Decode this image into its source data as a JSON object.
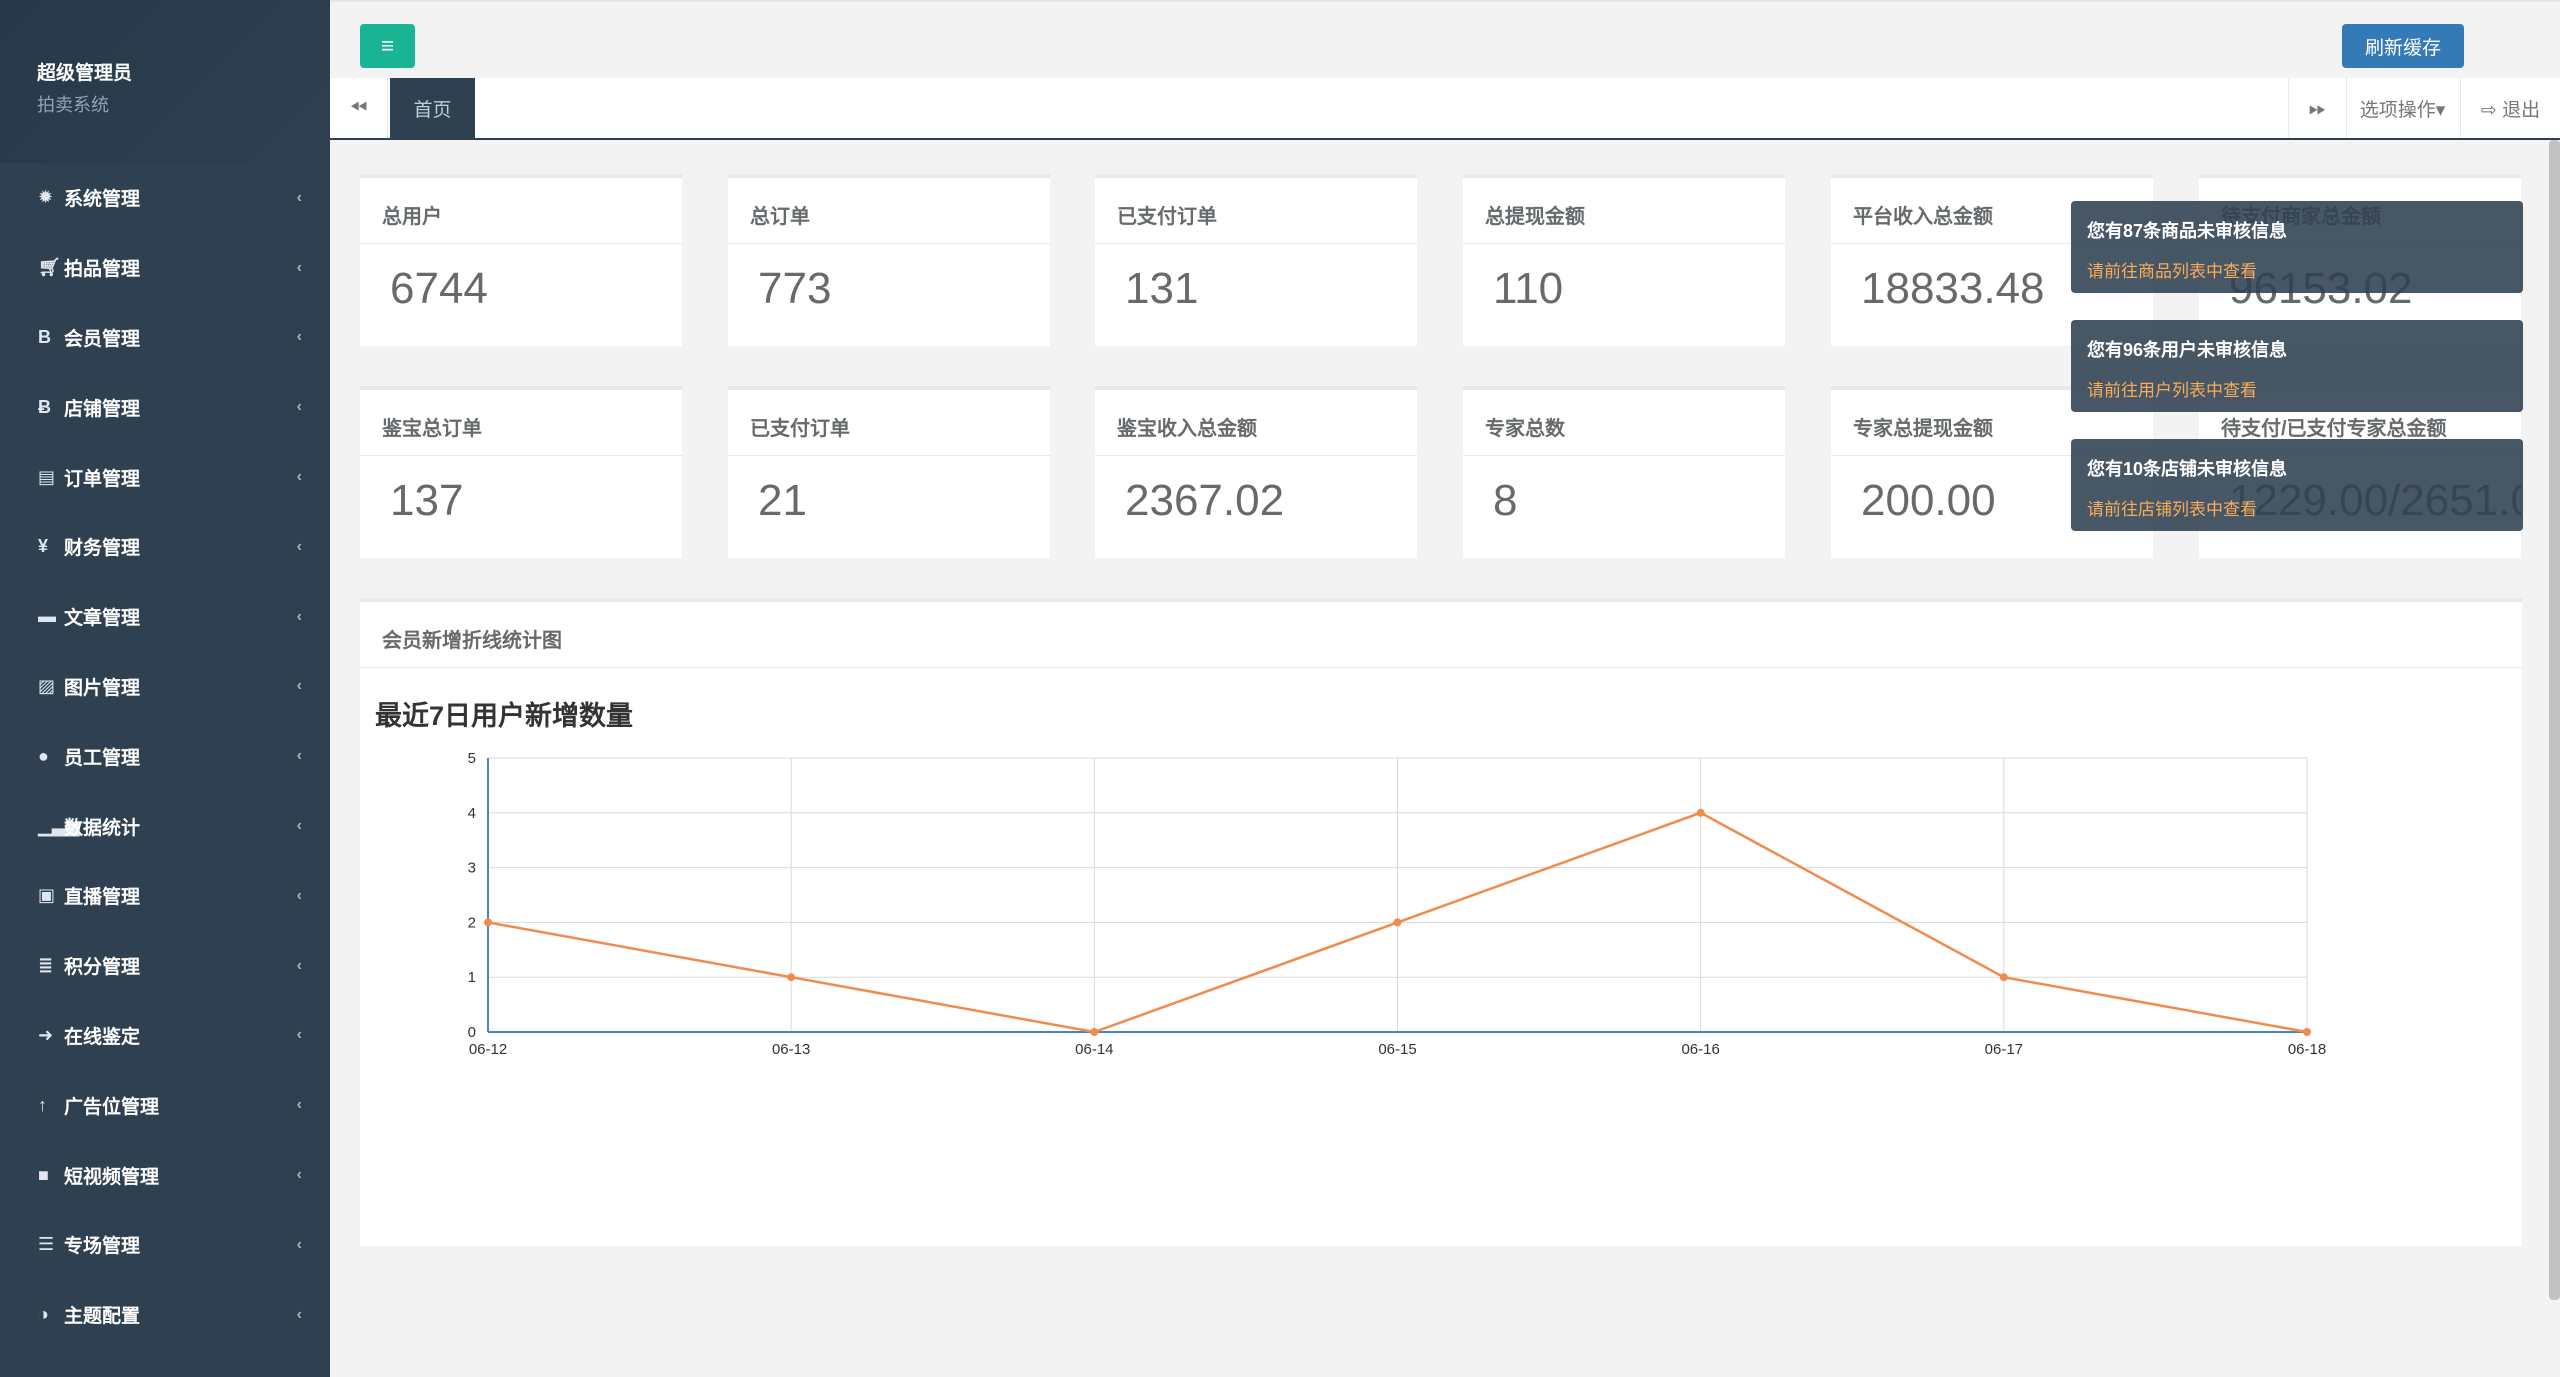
{
  "sidebar": {
    "profile_name": "超级管理员",
    "profile_sub": "拍卖系统",
    "items": [
      {
        "label": "系统管理",
        "icon": "✹",
        "icon_name": "gear-icon"
      },
      {
        "label": "拍品管理",
        "icon": "🛒︎",
        "icon_name": "cart-icon"
      },
      {
        "label": "会员管理",
        "icon": "B",
        "icon_name": "bitcoin-icon"
      },
      {
        "label": "店铺管理",
        "icon": "Ƀ",
        "icon_name": "bitcoin-icon"
      },
      {
        "label": "订单管理",
        "icon": "▤",
        "icon_name": "book-icon"
      },
      {
        "label": "财务管理",
        "icon": "¥",
        "icon_name": "yen-icon"
      },
      {
        "label": "文章管理",
        "icon": "▬",
        "icon_name": "briefcase-icon"
      },
      {
        "label": "图片管理",
        "icon": "▨",
        "icon_name": "image-icon"
      },
      {
        "label": "员工管理",
        "icon": "●",
        "icon_name": "user-icon"
      },
      {
        "label": "数据统计",
        "icon": "▁▃▅",
        "icon_name": "bar-chart-icon"
      },
      {
        "label": "直播管理",
        "icon": "▣",
        "icon_name": "tv-icon"
      },
      {
        "label": "积分管理",
        "icon": "≣",
        "icon_name": "database-icon"
      },
      {
        "label": "在线鉴定",
        "icon": "➜",
        "icon_name": "arrow-right-icon"
      },
      {
        "label": "广告位管理",
        "icon": "↑",
        "icon_name": "arrow-up-icon"
      },
      {
        "label": "短视频管理",
        "icon": "■",
        "icon_name": "video-icon"
      },
      {
        "label": "专场管理",
        "icon": "☰",
        "icon_name": "list-icon"
      },
      {
        "label": "主题配置",
        "icon": "◑",
        "icon_name": "adjust-icon"
      }
    ],
    "chevron": "‹"
  },
  "topbar": {
    "menu_icon": "≡",
    "refresh_label": "刷新缓存"
  },
  "tabs": {
    "left_arrow": "⏪︎",
    "home_label": "首页",
    "right_arrow": "⏩︎",
    "options_label": "选项操作▾",
    "logout_label": "⇨ 退出"
  },
  "stats_row1": [
    {
      "title": "总用户",
      "value": "6744"
    },
    {
      "title": "总订单",
      "value": "773"
    },
    {
      "title": "已支付订单",
      "value": "131"
    },
    {
      "title": "总提现金额",
      "value": "110"
    },
    {
      "title": "平台收入总金额",
      "value": "18833.48"
    },
    {
      "title": "待支付商家总金额",
      "value": "96153.02"
    }
  ],
  "stats_row2": [
    {
      "title": "鉴宝总订单",
      "value": "137"
    },
    {
      "title": "已支付订单",
      "value": "21"
    },
    {
      "title": "鉴宝收入总金额",
      "value": "2367.02"
    },
    {
      "title": "专家总数",
      "value": "8"
    },
    {
      "title": "专家总提现金额",
      "value": "200.00"
    },
    {
      "title": "待支付/已支付专家总金额",
      "value": "1229.00/2651.00"
    }
  ],
  "notifications": [
    {
      "title": "您有87条商品未审核信息",
      "link": "请前往商品列表中查看"
    },
    {
      "title": "您有96条用户未审核信息",
      "link": "请前往用户列表中查看"
    },
    {
      "title": "您有10条店铺未审核信息",
      "link": "请前往店铺列表中查看"
    }
  ],
  "chart_panel_title": "会员新增折线统计图",
  "chart_data": {
    "type": "line",
    "title": "最近7日用户新增数量",
    "categories": [
      "06-12",
      "06-13",
      "06-14",
      "06-15",
      "06-16",
      "06-17",
      "06-18"
    ],
    "series": [
      {
        "values": [
          2,
          1,
          0,
          2,
          4,
          1,
          0
        ],
        "color": "#f08b4c"
      }
    ],
    "ylim": [
      0,
      5
    ],
    "yticks": [
      0,
      1,
      2,
      3,
      4,
      5
    ],
    "grid": true,
    "axis_color": "#4a86c5"
  }
}
